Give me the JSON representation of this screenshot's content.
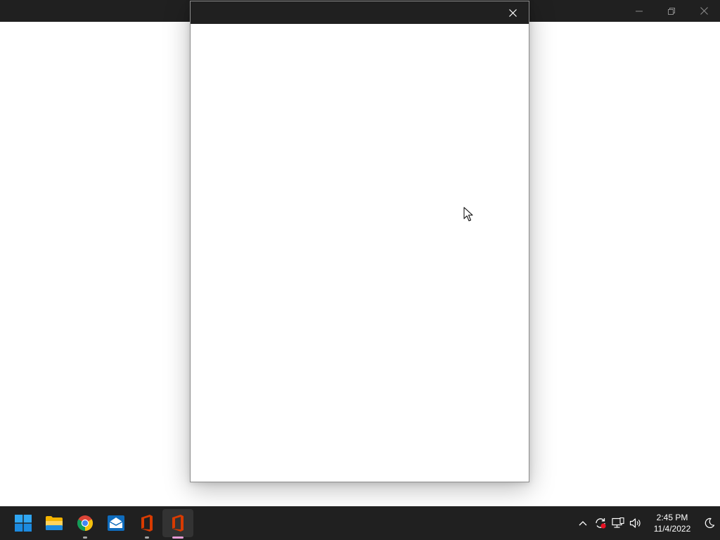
{
  "background_window": {
    "controls": {
      "minimize_icon": "minimize-icon",
      "restore_icon": "restore-icon",
      "close_icon": "close-icon"
    }
  },
  "dialog": {
    "close_icon": "close-icon"
  },
  "taskbar": {
    "apps": [
      {
        "name": "start",
        "icon": "windows-start-icon"
      },
      {
        "name": "file-explorer",
        "icon": "folder-icon"
      },
      {
        "name": "chrome",
        "icon": "chrome-icon",
        "running": true
      },
      {
        "name": "mail",
        "icon": "mail-icon"
      },
      {
        "name": "office",
        "icon": "office-icon",
        "running": true
      },
      {
        "name": "office-active",
        "icon": "office-icon",
        "active": true
      }
    ],
    "tray": {
      "icons": [
        "chevron-up-icon",
        "sync-icon",
        "network-icon",
        "volume-icon"
      ],
      "time": "2:45 PM",
      "date": "11/4/2022",
      "night_light_icon": "moon-icon"
    }
  },
  "colors": {
    "titlebar": "#202020",
    "taskbar": "#202020",
    "active_indicator": "#e89bd6",
    "office_red": "#d83b01",
    "sync_badge": "#e81123"
  }
}
